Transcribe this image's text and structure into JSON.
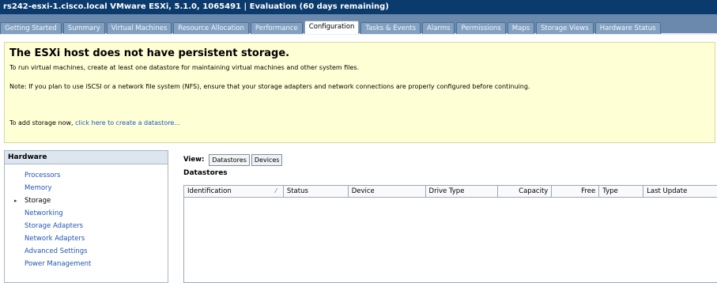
{
  "window": {
    "title": "rs242-esxi-1.cisco.local VMware ESXi, 5.1.0, 1065491 | Evaluation (60 days remaining)"
  },
  "tabs": [
    {
      "label": "Getting Started"
    },
    {
      "label": "Summary"
    },
    {
      "label": "Virtual Machines"
    },
    {
      "label": "Resource Allocation"
    },
    {
      "label": "Performance"
    },
    {
      "label": "Configuration",
      "active": true
    },
    {
      "label": "Tasks & Events"
    },
    {
      "label": "Alarms"
    },
    {
      "label": "Permissions"
    },
    {
      "label": "Maps"
    },
    {
      "label": "Storage Views"
    },
    {
      "label": "Hardware Status"
    }
  ],
  "notice": {
    "title": "The ESXi host does not have persistent storage.",
    "line1": "To run virtual machines, create at least one datastore for maintaining virtual machines and other system files.",
    "line2": "Note: If you plan to use iSCSI or a network file system (NFS), ensure that your storage adapters and network connections are properly configured before continuing.",
    "line3_prefix": "To add storage now, ",
    "line3_link": "click here to create a datastore..."
  },
  "hardware": {
    "header": "Hardware",
    "items": [
      {
        "label": "Processors"
      },
      {
        "label": "Memory"
      },
      {
        "label": "Storage",
        "active": true
      },
      {
        "label": "Networking"
      },
      {
        "label": "Storage Adapters"
      },
      {
        "label": "Network Adapters"
      },
      {
        "label": "Advanced Settings"
      },
      {
        "label": "Power Management"
      }
    ]
  },
  "view": {
    "label": "View:",
    "datastores_btn": "Datastores",
    "devices_btn": "Devices"
  },
  "datastores": {
    "title": "Datastores",
    "columns": [
      "Identification",
      "Status",
      "Device",
      "Drive Type",
      "Capacity",
      "Free",
      "Type",
      "Last Update"
    ]
  },
  "colors": {
    "title_bar": "#0b3a6c",
    "tab_bar": "#6a89ac",
    "notice_bg": "#ffffd6",
    "link": "#1a56c8"
  }
}
